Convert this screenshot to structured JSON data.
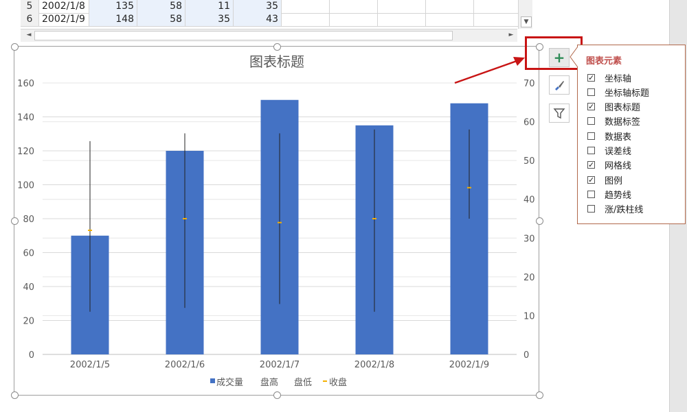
{
  "sheet": {
    "rows": [
      {
        "row": "5",
        "date": "2002/1/8",
        "v1": "135",
        "v2": "58",
        "v3": "11",
        "v4": "35"
      },
      {
        "row": "6",
        "date": "2002/1/9",
        "v1": "148",
        "v2": "58",
        "v3": "35",
        "v4": "43"
      }
    ]
  },
  "scrollbar": {
    "up": "◄",
    "right": "►",
    "down": "▼"
  },
  "chart_panel": {
    "plus_label": "+",
    "panel_title": "图表元素",
    "options": [
      {
        "label": "坐标轴",
        "checked": true
      },
      {
        "label": "坐标轴标题",
        "checked": false
      },
      {
        "label": "图表标题",
        "checked": true
      },
      {
        "label": "数据标签",
        "checked": false
      },
      {
        "label": "数据表",
        "checked": false
      },
      {
        "label": "误差线",
        "checked": false
      },
      {
        "label": "网格线",
        "checked": true
      },
      {
        "label": "图例",
        "checked": true
      },
      {
        "label": "趋势线",
        "checked": false
      },
      {
        "label": "涨/跌柱线",
        "checked": false
      }
    ],
    "icons": [
      "plus-icon",
      "brush-icon",
      "filter-icon"
    ],
    "highlight_color": "#c81414"
  },
  "chart_data": {
    "type": "bar",
    "title": "图表标题",
    "categories": [
      "2002/1/5",
      "2002/1/6",
      "2002/1/7",
      "2002/1/8",
      "2002/1/9"
    ],
    "series": [
      {
        "name": "成交量",
        "axis": "left",
        "values": [
          70,
          120,
          150,
          135,
          148
        ],
        "color": "#4472c4"
      },
      {
        "name": "盘高",
        "axis": "right",
        "values": [
          55,
          57,
          57,
          58,
          58
        ]
      },
      {
        "name": "盘低",
        "axis": "right",
        "values": [
          11,
          12,
          13,
          11,
          35
        ]
      },
      {
        "name": "收盘",
        "axis": "right",
        "values": [
          32,
          35,
          34,
          35,
          43
        ],
        "color": "#f5b000"
      }
    ],
    "left_axis": {
      "ylim": [
        0,
        160
      ],
      "ticks": [
        0,
        20,
        40,
        60,
        80,
        100,
        120,
        140,
        160
      ]
    },
    "right_axis": {
      "ylim": [
        0,
        70
      ],
      "ticks": [
        0,
        10,
        20,
        30,
        40,
        50,
        60,
        70
      ]
    },
    "grid": true,
    "legend_position": "bottom",
    "legend": [
      "成交量",
      "盘高",
      "盘低",
      "收盘"
    ]
  }
}
